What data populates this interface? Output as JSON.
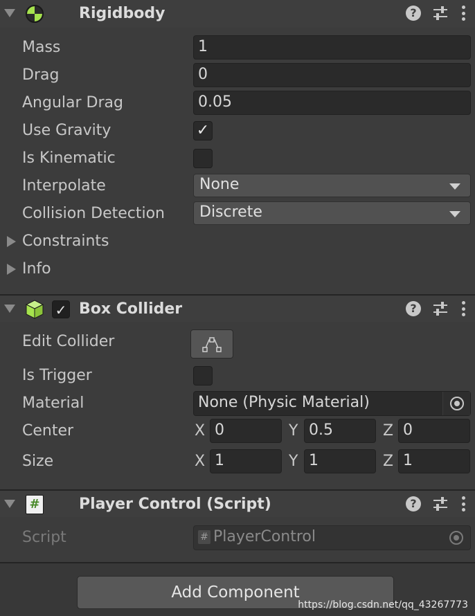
{
  "rigidbody": {
    "title": "Rigidbody",
    "help_symbol": "?",
    "fields": {
      "mass": {
        "label": "Mass",
        "value": "1"
      },
      "drag": {
        "label": "Drag",
        "value": "0"
      },
      "angular_drag": {
        "label": "Angular Drag",
        "value": "0.05"
      },
      "use_gravity": {
        "label": "Use Gravity",
        "checked": true,
        "glyph": "✓"
      },
      "is_kinematic": {
        "label": "Is Kinematic",
        "checked": false
      },
      "interpolate": {
        "label": "Interpolate",
        "value": "None"
      },
      "collision_detection": {
        "label": "Collision Detection",
        "value": "Discrete"
      }
    },
    "foldouts": {
      "constraints": "Constraints",
      "info": "Info"
    }
  },
  "box_collider": {
    "title": "Box Collider",
    "enabled": true,
    "enabled_glyph": "✓",
    "help_symbol": "?",
    "fields": {
      "edit_collider": {
        "label": "Edit Collider"
      },
      "is_trigger": {
        "label": "Is Trigger",
        "checked": false
      },
      "material": {
        "label": "Material",
        "value": "None (Physic Material)"
      },
      "center": {
        "label": "Center",
        "x_label": "X",
        "y_label": "Y",
        "z_label": "Z",
        "x": "0",
        "y": "0.5",
        "z": "0"
      },
      "size": {
        "label": "Size",
        "x_label": "X",
        "y_label": "Y",
        "z_label": "Z",
        "x": "1",
        "y": "1",
        "z": "1"
      }
    }
  },
  "player_control": {
    "title": "Player Control (Script)",
    "help_symbol": "?",
    "icon_glyph": "#",
    "script": {
      "label": "Script",
      "value": "PlayerControl",
      "icon_glyph": "#"
    }
  },
  "add_component_label": "Add Component",
  "watermark": "https://blog.csdn.net/qq_43267773",
  "icons": {
    "rigidbody": "rigidbody-icon",
    "box_collider": "cube-icon",
    "script": "script-hash-icon",
    "help": "help-icon",
    "presets": "presets-icon",
    "more": "more-vertical-icon",
    "edit": "edit-bounds-icon",
    "object_picker": "object-picker-icon"
  },
  "colors": {
    "accent_green": "#a6e34e",
    "panel_bg": "#3c3c3c",
    "field_bg": "#2a2a2a",
    "button_bg": "#585858"
  }
}
